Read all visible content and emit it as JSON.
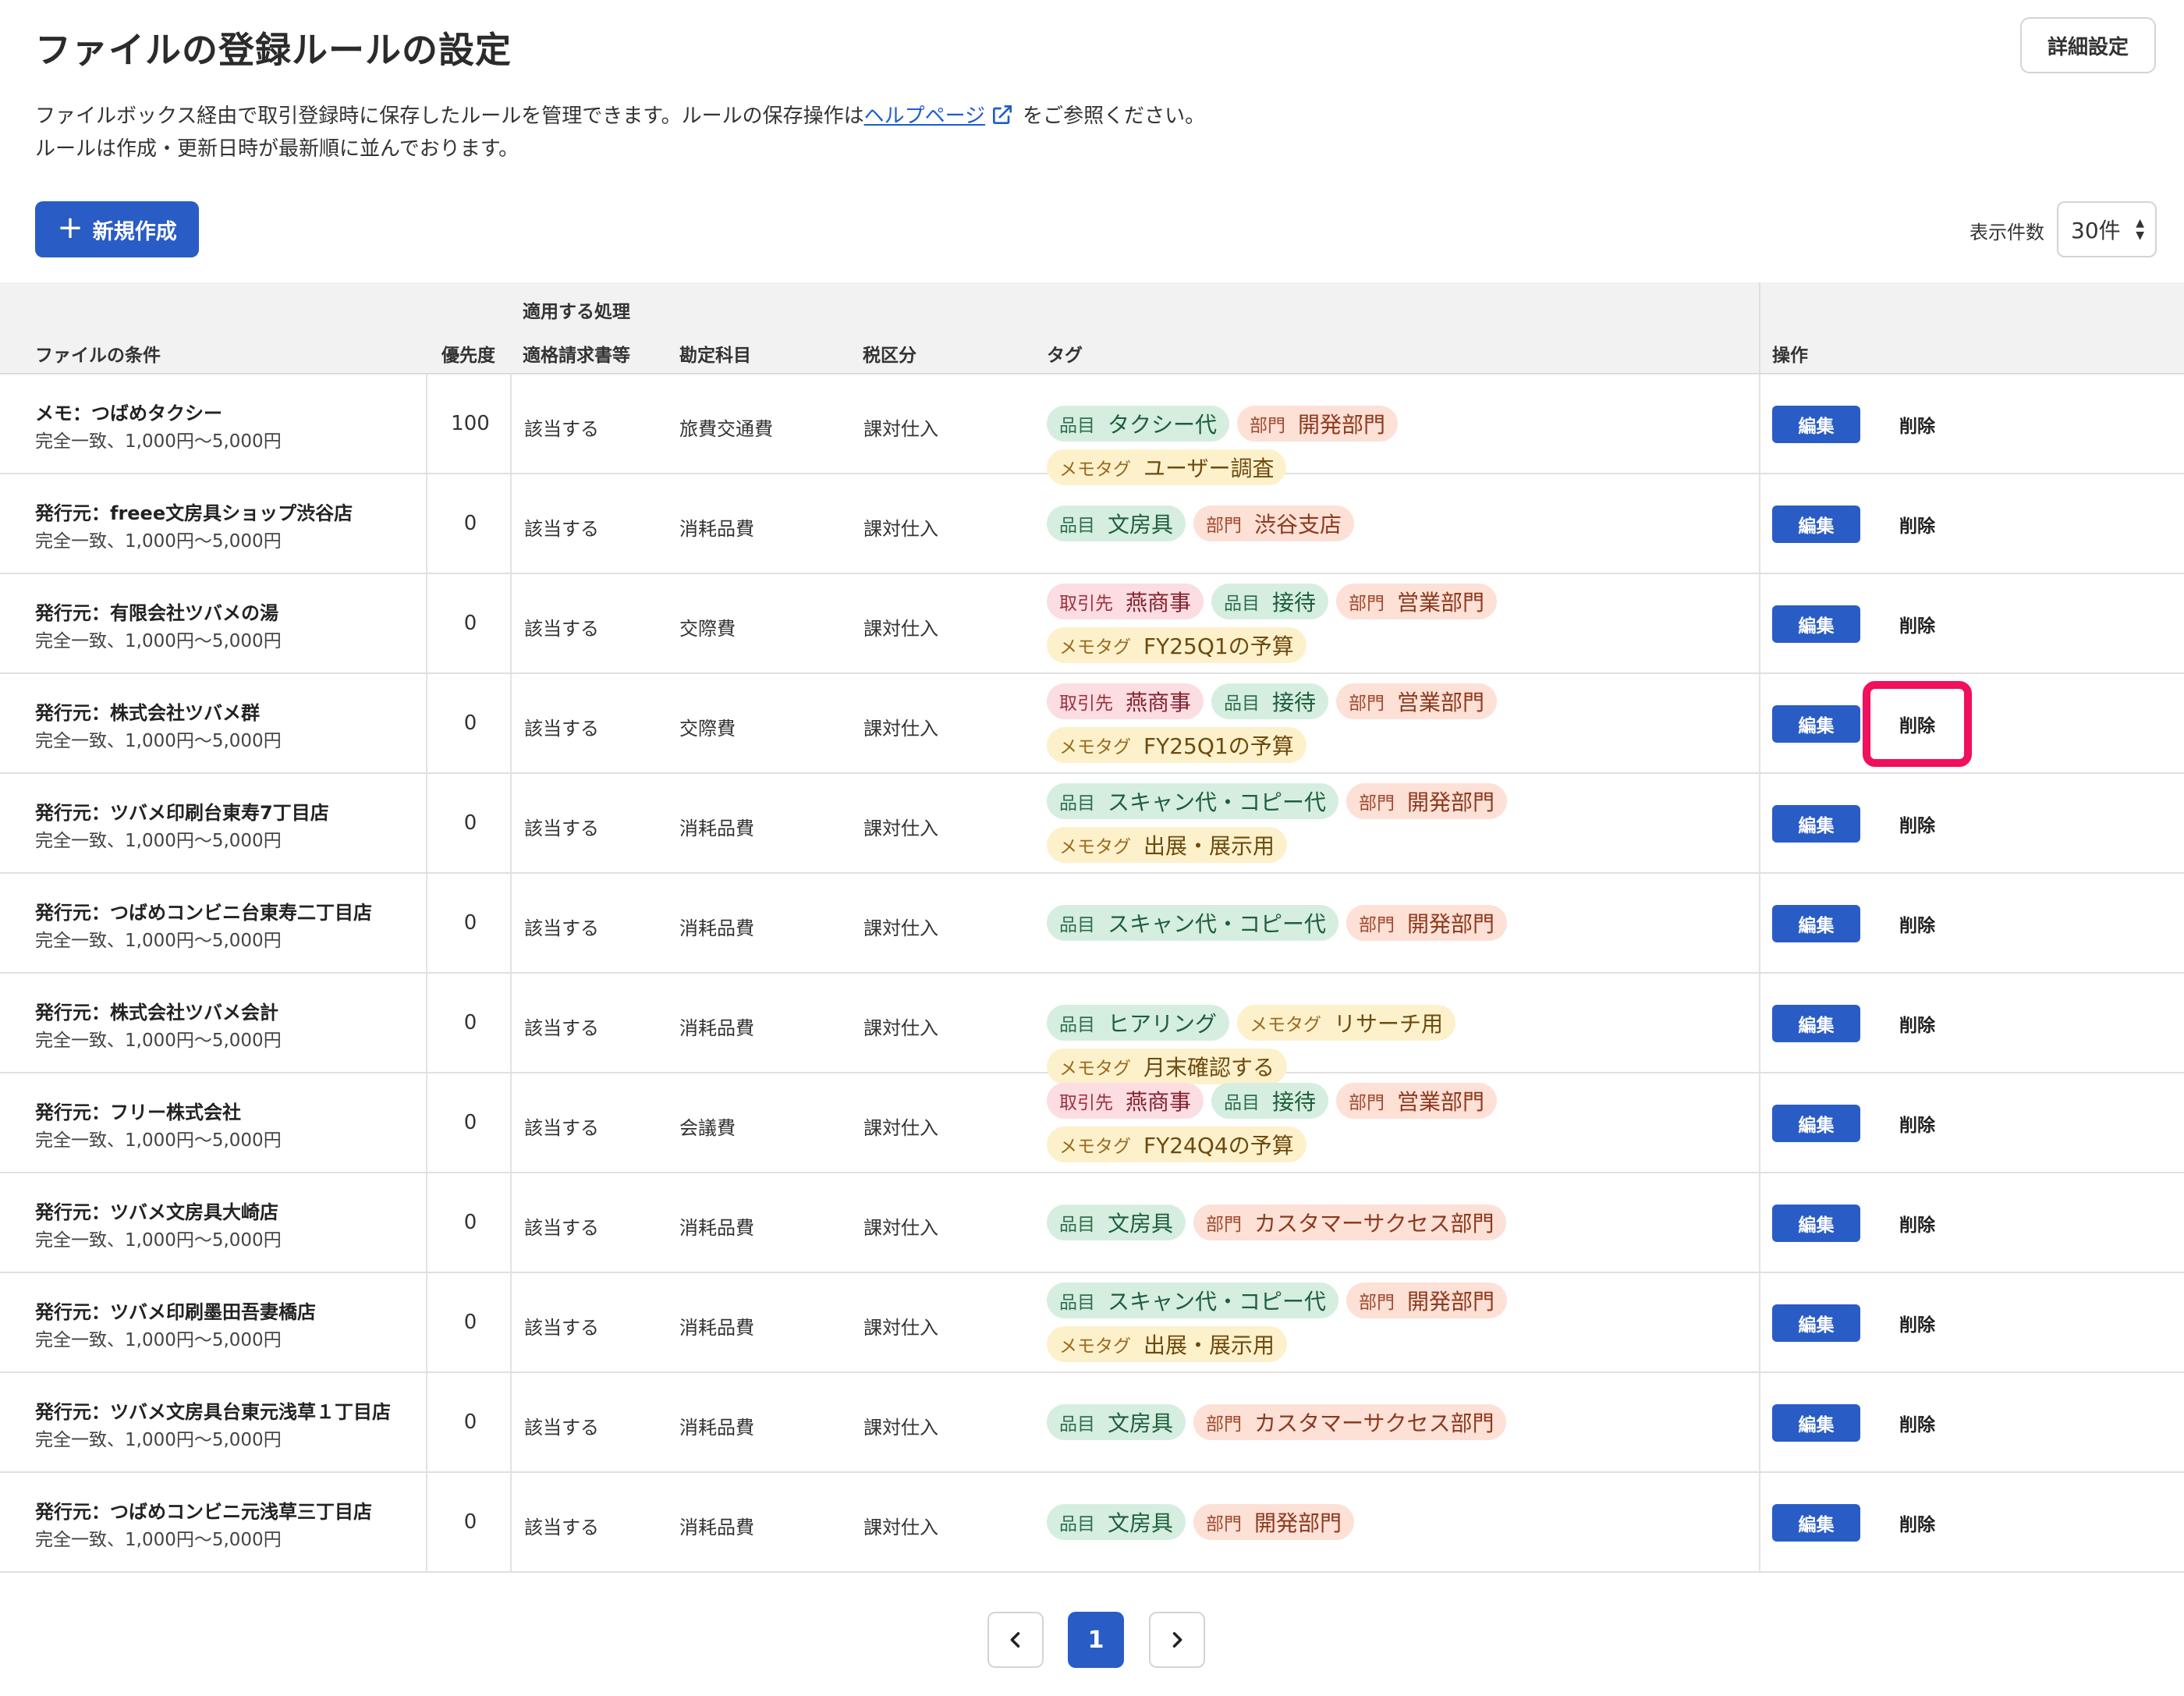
{
  "header": {
    "title": "ファイルの登録ルールの設定",
    "detail_button": "詳細設定",
    "desc_line1_prefix": "ファイルボックス経由で取引登録時に保存したルールを管理できます。ルールの保存操作は",
    "help_link": "ヘルプページ",
    "desc_line1_suffix": "をご参照ください。",
    "desc_line2": "ルールは作成・更新日時が最新順に並んでおります。",
    "new_button": "新規作成",
    "count_label": "表示件数",
    "count_value": "30件"
  },
  "table": {
    "group_header": "適用する処理",
    "columns": {
      "condition": "ファイルの条件",
      "priority": "優先度",
      "invoice": "適格請求書等",
      "account": "勘定科目",
      "tax": "税区分",
      "tags": "タグ",
      "actions": "操作"
    },
    "edit_label": "編集",
    "delete_label": "削除",
    "rows": [
      {
        "title": "メモ：つばめタクシー",
        "sub": "完全一致、1,000円〜5,000円",
        "priority": "100",
        "invoice": "該当する",
        "account": "旅費交通費",
        "tax": "課対仕入",
        "tags": [
          {
            "k": "品目",
            "v": "タクシー代",
            "c": "green"
          },
          {
            "k": "部門",
            "v": "開発部門",
            "c": "orange"
          },
          {
            "k": "メモタグ",
            "v": "ユーザー調査",
            "c": "yellow"
          }
        ]
      },
      {
        "title": "発行元：freee文房具ショップ渋谷店",
        "sub": "完全一致、1,000円〜5,000円",
        "priority": "0",
        "invoice": "該当する",
        "account": "消耗品費",
        "tax": "課対仕入",
        "tags": [
          {
            "k": "品目",
            "v": "文房具",
            "c": "green"
          },
          {
            "k": "部門",
            "v": "渋谷支店",
            "c": "orange"
          }
        ]
      },
      {
        "title": "発行元：有限会社ツバメの湯",
        "sub": "完全一致、1,000円〜5,000円",
        "priority": "0",
        "invoice": "該当する",
        "account": "交際費",
        "tax": "課対仕入",
        "tags": [
          {
            "k": "取引先",
            "v": "燕商事",
            "c": "pink"
          },
          {
            "k": "品目",
            "v": "接待",
            "c": "green"
          },
          {
            "k": "部門",
            "v": "営業部門",
            "c": "orange"
          },
          {
            "k": "メモタグ",
            "v": "FY25Q1の予算",
            "c": "yellow"
          }
        ]
      },
      {
        "title": "発行元：株式会社ツバメ群",
        "sub": "完全一致、1,000円〜5,000円",
        "priority": "0",
        "invoice": "該当する",
        "account": "交際費",
        "tax": "課対仕入",
        "tags": [
          {
            "k": "取引先",
            "v": "燕商事",
            "c": "pink"
          },
          {
            "k": "品目",
            "v": "接待",
            "c": "green"
          },
          {
            "k": "部門",
            "v": "営業部門",
            "c": "orange"
          },
          {
            "k": "メモタグ",
            "v": "FY25Q1の予算",
            "c": "yellow"
          }
        ]
      },
      {
        "title": "発行元：ツバメ印刷台東寿7丁目店",
        "sub": "完全一致、1,000円〜5,000円",
        "priority": "0",
        "invoice": "該当する",
        "account": "消耗品費",
        "tax": "課対仕入",
        "tags": [
          {
            "k": "品目",
            "v": "スキャン代・コピー代",
            "c": "green"
          },
          {
            "k": "部門",
            "v": "開発部門",
            "c": "orange"
          },
          {
            "k": "メモタグ",
            "v": "出展・展示用",
            "c": "yellow"
          }
        ]
      },
      {
        "title": "発行元：つばめコンビニ台東寿二丁目店",
        "sub": "完全一致、1,000円〜5,000円",
        "priority": "0",
        "invoice": "該当する",
        "account": "消耗品費",
        "tax": "課対仕入",
        "tags": [
          {
            "k": "品目",
            "v": "スキャン代・コピー代",
            "c": "green"
          },
          {
            "k": "部門",
            "v": "開発部門",
            "c": "orange"
          }
        ]
      },
      {
        "title": "発行元：株式会社ツバメ会計",
        "sub": "完全一致、1,000円〜5,000円",
        "priority": "0",
        "invoice": "該当する",
        "account": "消耗品費",
        "tax": "課対仕入",
        "tags": [
          {
            "k": "品目",
            "v": "ヒアリング",
            "c": "green"
          },
          {
            "k": "メモタグ",
            "v": "リサーチ用",
            "c": "yellow"
          },
          {
            "k": "メモタグ",
            "v": "月末確認する",
            "c": "yellow"
          }
        ]
      },
      {
        "title": "発行元：フリー株式会社",
        "sub": "完全一致、1,000円〜5,000円",
        "priority": "0",
        "invoice": "該当する",
        "account": "会議費",
        "tax": "課対仕入",
        "tags": [
          {
            "k": "取引先",
            "v": "燕商事",
            "c": "pink"
          },
          {
            "k": "品目",
            "v": "接待",
            "c": "green"
          },
          {
            "k": "部門",
            "v": "営業部門",
            "c": "orange"
          },
          {
            "k": "メモタグ",
            "v": "FY24Q4の予算",
            "c": "yellow"
          }
        ]
      },
      {
        "title": "発行元：ツバメ文房具大崎店",
        "sub": "完全一致、1,000円〜5,000円",
        "priority": "0",
        "invoice": "該当する",
        "account": "消耗品費",
        "tax": "課対仕入",
        "tags": [
          {
            "k": "品目",
            "v": "文房具",
            "c": "green"
          },
          {
            "k": "部門",
            "v": "カスタマーサクセス部門",
            "c": "orange"
          }
        ]
      },
      {
        "title": "発行元：ツバメ印刷墨田吾妻橋店",
        "sub": "完全一致、1,000円〜5,000円",
        "priority": "0",
        "invoice": "該当する",
        "account": "消耗品費",
        "tax": "課対仕入",
        "tags": [
          {
            "k": "品目",
            "v": "スキャン代・コピー代",
            "c": "green"
          },
          {
            "k": "部門",
            "v": "開発部門",
            "c": "orange"
          },
          {
            "k": "メモタグ",
            "v": "出展・展示用",
            "c": "yellow"
          }
        ]
      },
      {
        "title": "発行元：ツバメ文房具台東元浅草１丁目店",
        "sub": "完全一致、1,000円〜5,000円",
        "priority": "0",
        "invoice": "該当する",
        "account": "消耗品費",
        "tax": "課対仕入",
        "tags": [
          {
            "k": "品目",
            "v": "文房具",
            "c": "green"
          },
          {
            "k": "部門",
            "v": "カスタマーサクセス部門",
            "c": "orange"
          }
        ]
      },
      {
        "title": "発行元：つばめコンビニ元浅草三丁目店",
        "sub": "完全一致、1,000円〜5,000円",
        "priority": "0",
        "invoice": "該当する",
        "account": "消耗品費",
        "tax": "課対仕入",
        "tags": [
          {
            "k": "品目",
            "v": "文房具",
            "c": "green"
          },
          {
            "k": "部門",
            "v": "開発部門",
            "c": "orange"
          }
        ]
      }
    ]
  },
  "pagination": {
    "current": "1"
  },
  "colors": {
    "primary": "#2a5cc5",
    "highlight": "#f0105c"
  }
}
